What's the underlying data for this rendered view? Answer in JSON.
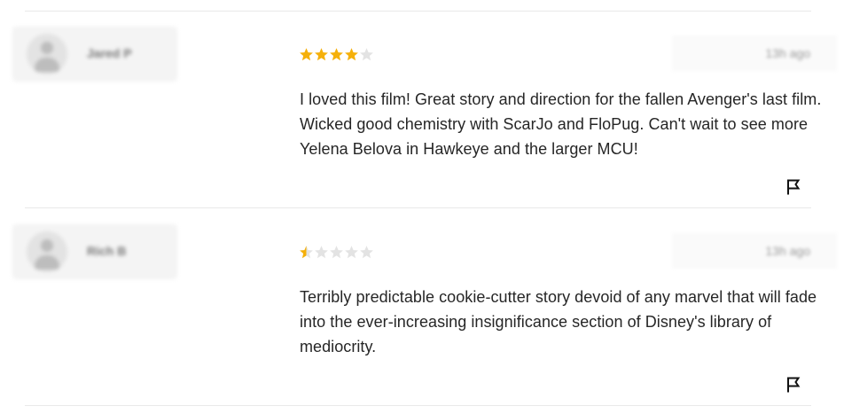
{
  "reviews": [
    {
      "user_name": "Jared P",
      "rating": 4,
      "max_rating": 5,
      "timestamp": "13h ago",
      "text": "I loved this film! Great story and direction for the fallen Avenger's last film. Wicked good chemistry with ScarJo and FloPug. Can't wait to see more Yelena Belova in Hawkeye and the larger MCU!",
      "flag_icon": "flag-icon"
    },
    {
      "user_name": "Rich B",
      "rating": 0.5,
      "max_rating": 5,
      "timestamp": "13h ago",
      "text": "Terribly predictable cookie-cutter story devoid of any marvel that will fade into the ever-increasing insignificance section of Disney's library of mediocrity.",
      "flag_icon": "flag-icon"
    }
  ],
  "colors": {
    "star_filled": "#f5b00a",
    "star_empty": "#e3e3e3",
    "divider": "#e9e9e9"
  }
}
